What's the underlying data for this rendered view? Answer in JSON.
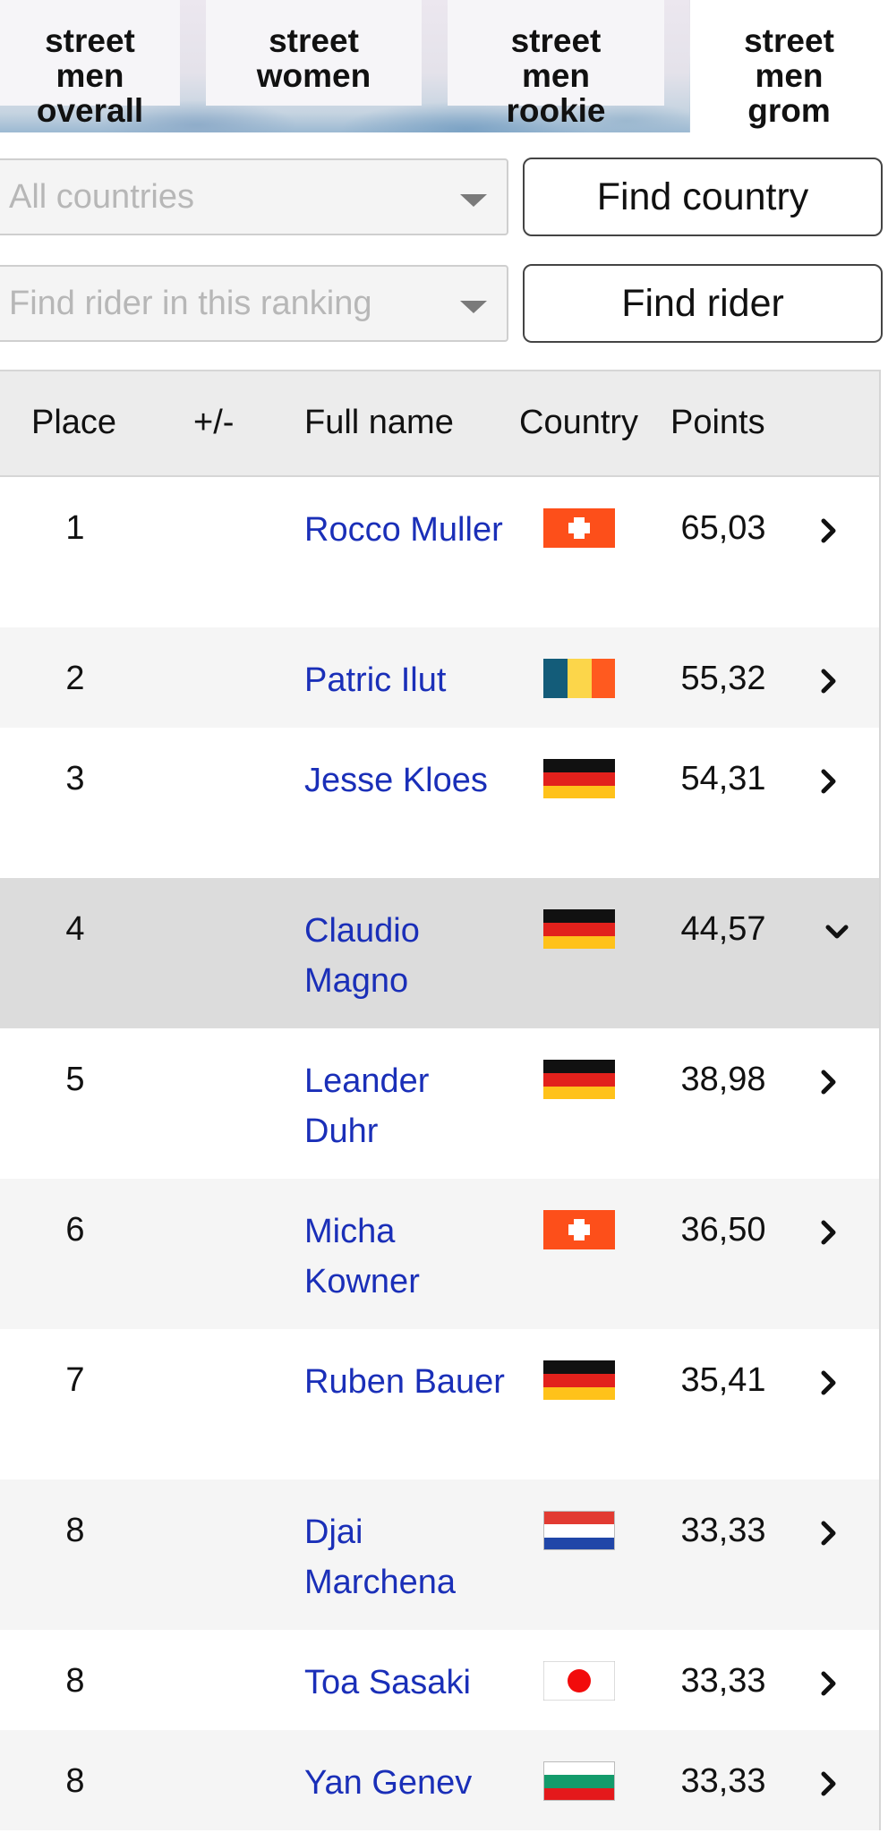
{
  "tabs": [
    {
      "label": "street\nmen\noverall"
    },
    {
      "label": "street\nwomen"
    },
    {
      "label": "street\nmen\nrookie"
    },
    {
      "label": "street\nmen\ngrom"
    }
  ],
  "filters": {
    "country_select": "All countries",
    "find_country": "Find country",
    "rider_select": "Find rider in this ranking",
    "find_rider": "Find rider"
  },
  "table": {
    "headers": {
      "place": "Place",
      "change": "+/-",
      "full_name": "Full name",
      "country": "Country",
      "points": "Points"
    },
    "rows": [
      {
        "place": "1",
        "name": "Rocco Muller",
        "country": "switzerland",
        "points": "65,03",
        "expanded": false
      },
      {
        "place": "2",
        "name": "Patric Ilut",
        "country": "romania",
        "points": "55,32",
        "expanded": false
      },
      {
        "place": "3",
        "name": "Jesse Kloes",
        "country": "germany",
        "points": "54,31",
        "expanded": false
      },
      {
        "place": "4",
        "name": "Claudio Magno",
        "country": "germany",
        "points": "44,57",
        "expanded": true
      },
      {
        "place": "5",
        "name": "Leander Duhr",
        "country": "germany",
        "points": "38,98",
        "expanded": false
      },
      {
        "place": "6",
        "name": "Micha Kowner",
        "country": "switzerland",
        "points": "36,50",
        "expanded": false
      },
      {
        "place": "7",
        "name": "Ruben Bauer",
        "country": "germany",
        "points": "35,41",
        "expanded": false
      },
      {
        "place": "8",
        "name": "Djai Marchena",
        "country": "netherlands",
        "points": "33,33",
        "expanded": false
      },
      {
        "place": "8",
        "name": "Toa Sasaki",
        "country": "japan",
        "points": "33,33",
        "expanded": false
      },
      {
        "place": "8",
        "name": "Yan Genev",
        "country": "bulgaria",
        "points": "33,33",
        "expanded": false
      }
    ]
  },
  "colors": {
    "link": "#1a2fb8",
    "selected_row": "#dcdcdc",
    "alt_row": "#f5f5f5"
  }
}
